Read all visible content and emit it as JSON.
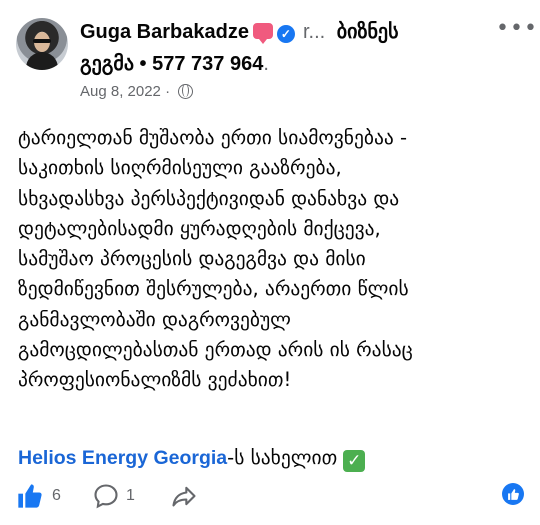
{
  "post": {
    "author": "Guga Barbakadze",
    "group_truncated": "r...",
    "group_name_part1": "ბიზნეს",
    "group_name_part2": "გეგმა • 577 737 964",
    "group_name_suffix": ".",
    "date": "Aug 8, 2022",
    "date_separator": "·",
    "privacy_icon": "globe-icon",
    "more_label": "•••",
    "body_lines": [
      "ტარიელთან მუშაობა ერთი სიამოვნებაა -",
      "საკითხის სიღრმისეული გააზრება,",
      "სხვადასხვა პერსპექტივიდან დანახვა და",
      "დეტალებისადმი ყურადღების მიქცევა,",
      "სამუშაო პროცესის დაგეგმვა და მისი",
      "ზედმიწევნით შესრულება, არაერთი წლის",
      "განმავლობაში დაგროვებულ",
      "გამოცდილებასთან ერთად არის ის რასაც",
      "პროფესიონალიზმს ვეძახით!"
    ],
    "tag_link": "Helios Energy Georgia",
    "tag_suffix": "-ს სახელით",
    "check_emoji": "✓"
  },
  "footer": {
    "like_count": "6",
    "comment_count": "1",
    "like_icon": "thumbs-up-icon",
    "comment_icon": "comment-icon",
    "share_icon": "share-icon"
  },
  "colors": {
    "accent": "#1877f2",
    "link": "#1a66d6",
    "secondary_text": "#65676b",
    "check_green": "#4caf50",
    "badge_pink": "#f05a7e"
  }
}
